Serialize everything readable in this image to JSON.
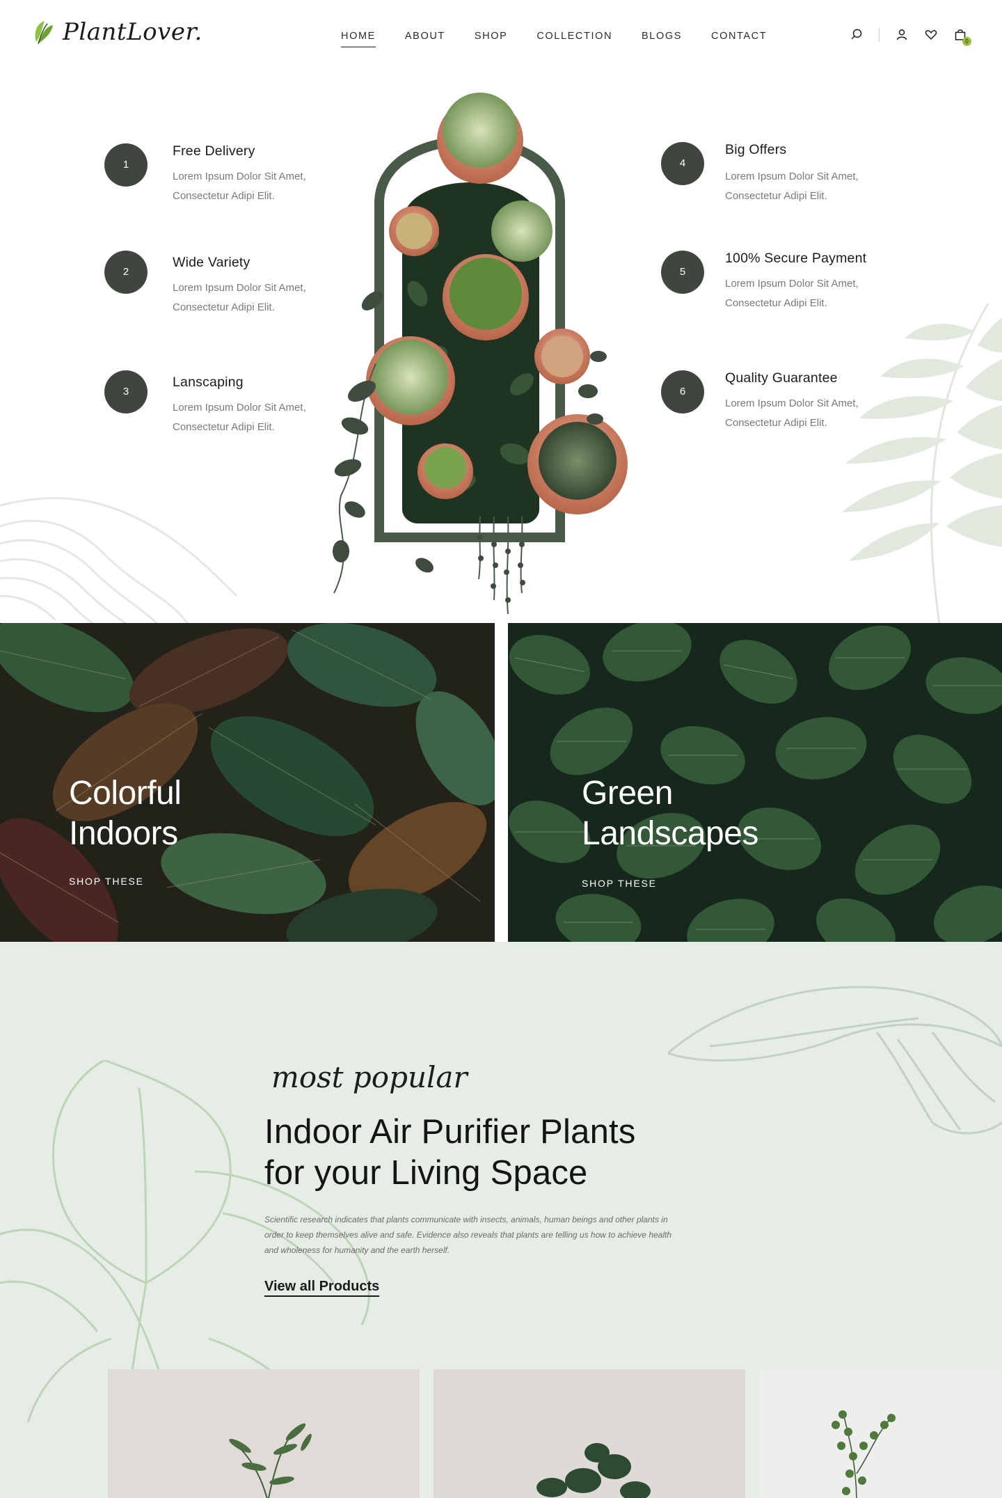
{
  "brand": {
    "name": "PlantLover.",
    "accent": "#8cc43f"
  },
  "nav": {
    "items": [
      {
        "label": "HOME",
        "active": true
      },
      {
        "label": "ABOUT"
      },
      {
        "label": "SHOP"
      },
      {
        "label": "COLLECTION"
      },
      {
        "label": "BLOGS"
      },
      {
        "label": "CONTACT"
      }
    ]
  },
  "header_icons": {
    "search": "search-icon",
    "account": "user-icon",
    "wishlist": "heart-icon",
    "cart": "shopping-bag-icon",
    "cart_count": "0"
  },
  "features": [
    {
      "num": "1",
      "title": "Free Delivery",
      "desc": "Lorem Ipsum Dolor Sit Amet, Consectetur Adipi Elit."
    },
    {
      "num": "2",
      "title": "Wide Variety",
      "desc": "Lorem Ipsum Dolor Sit Amet, Consectetur Adipi Elit."
    },
    {
      "num": "3",
      "title": "Lanscaping",
      "desc": "Lorem Ipsum Dolor Sit Amet, Consectetur Adipi Elit."
    },
    {
      "num": "4",
      "title": "Big Offers",
      "desc": "Lorem Ipsum Dolor Sit Amet, Consectetur Adipi Elit."
    },
    {
      "num": "5",
      "title": "100% Secure Payment",
      "desc": "Lorem Ipsum Dolor Sit Amet, Consectetur Adipi Elit."
    },
    {
      "num": "6",
      "title": "Quality Guarantee",
      "desc": "Lorem Ipsum Dolor Sit Amet, Consectetur Adipi Elit."
    }
  ],
  "promos": [
    {
      "title_line1": "Colorful",
      "title_line2": "Indoors",
      "cta": "SHOP THESE"
    },
    {
      "title_line1": "Green",
      "title_line2": "Landscapes",
      "cta": "SHOP THESE"
    }
  ],
  "popular": {
    "script": "most popular",
    "title_line1": "Indoor Air Purifier Plants",
    "title_line2": "for your Living Space",
    "desc": "Scientific research indicates that plants communicate with insects, animals, human beings and other plants in order to keep themselves alive and safe. Evidence also reveals that plants are telling us how to achieve health and wholeness for humanity and the earth herself.",
    "link": "View all Products"
  },
  "colors": {
    "circle": "#3f463f",
    "popular_bg": "#e6ece6",
    "frame_green": "#4a5a48"
  }
}
